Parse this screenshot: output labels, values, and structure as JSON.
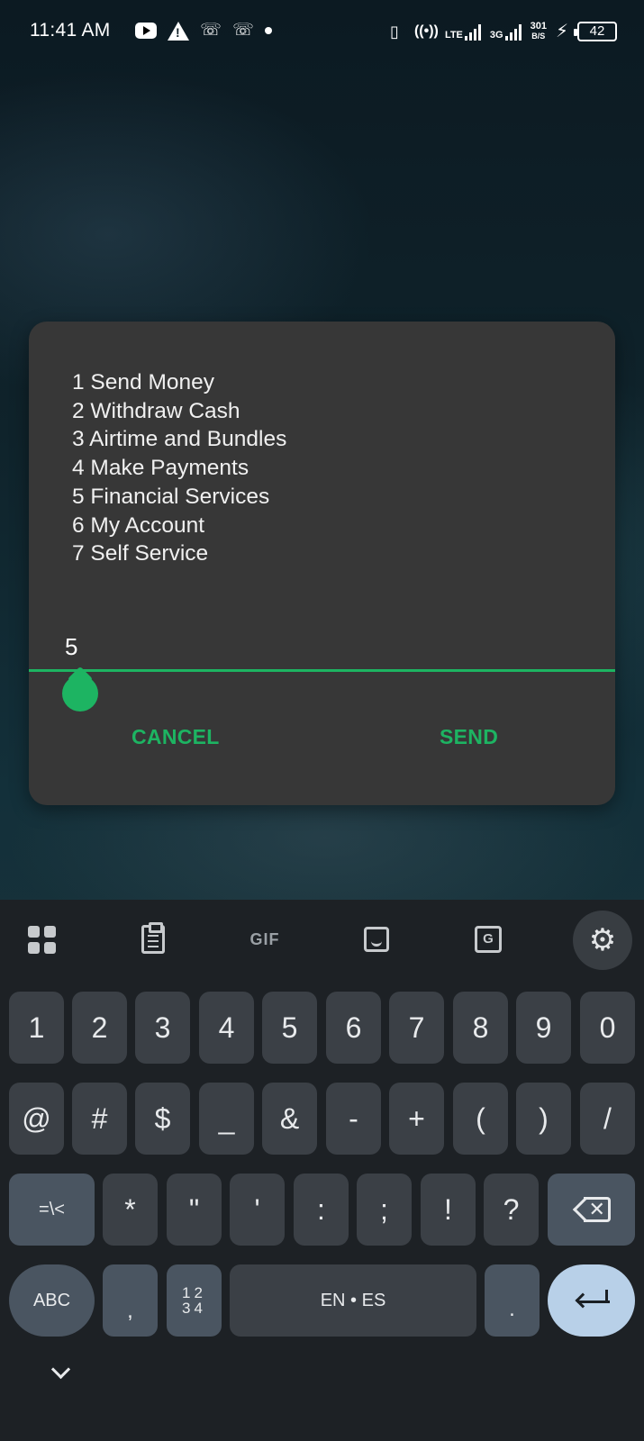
{
  "status_bar": {
    "time": "11:41 AM",
    "network_lte": "LTE",
    "network_3g": "3G",
    "speed_value": "301",
    "speed_unit": "B/S",
    "battery": "42"
  },
  "dialog": {
    "menu_items": [
      "1 Send Money",
      "2 Withdraw Cash",
      "3 Airtime and Bundles",
      "4 Make Payments",
      "5 Financial Services",
      "6 My Account",
      "7 Self Service"
    ],
    "input_value": "5",
    "cancel_label": "CANCEL",
    "send_label": "SEND",
    "accent_color": "#1db462"
  },
  "keyboard": {
    "toolbar": {
      "gif_label": "GIF",
      "translate_label": "G"
    },
    "row1": [
      "1",
      "2",
      "3",
      "4",
      "5",
      "6",
      "7",
      "8",
      "9",
      "0"
    ],
    "row2": [
      "@",
      "#",
      "$",
      "_",
      "&",
      "-",
      "+",
      "(",
      ")",
      "/"
    ],
    "row3": [
      "*",
      "\"",
      "'",
      ":",
      ";",
      "!",
      "?"
    ],
    "symbols_key": "=\\<",
    "abc_key": "ABC",
    "comma_key": ",",
    "numpad_key_top": "12",
    "numpad_key_bottom": "34",
    "space_label": "EN • ES",
    "period_key": "."
  }
}
